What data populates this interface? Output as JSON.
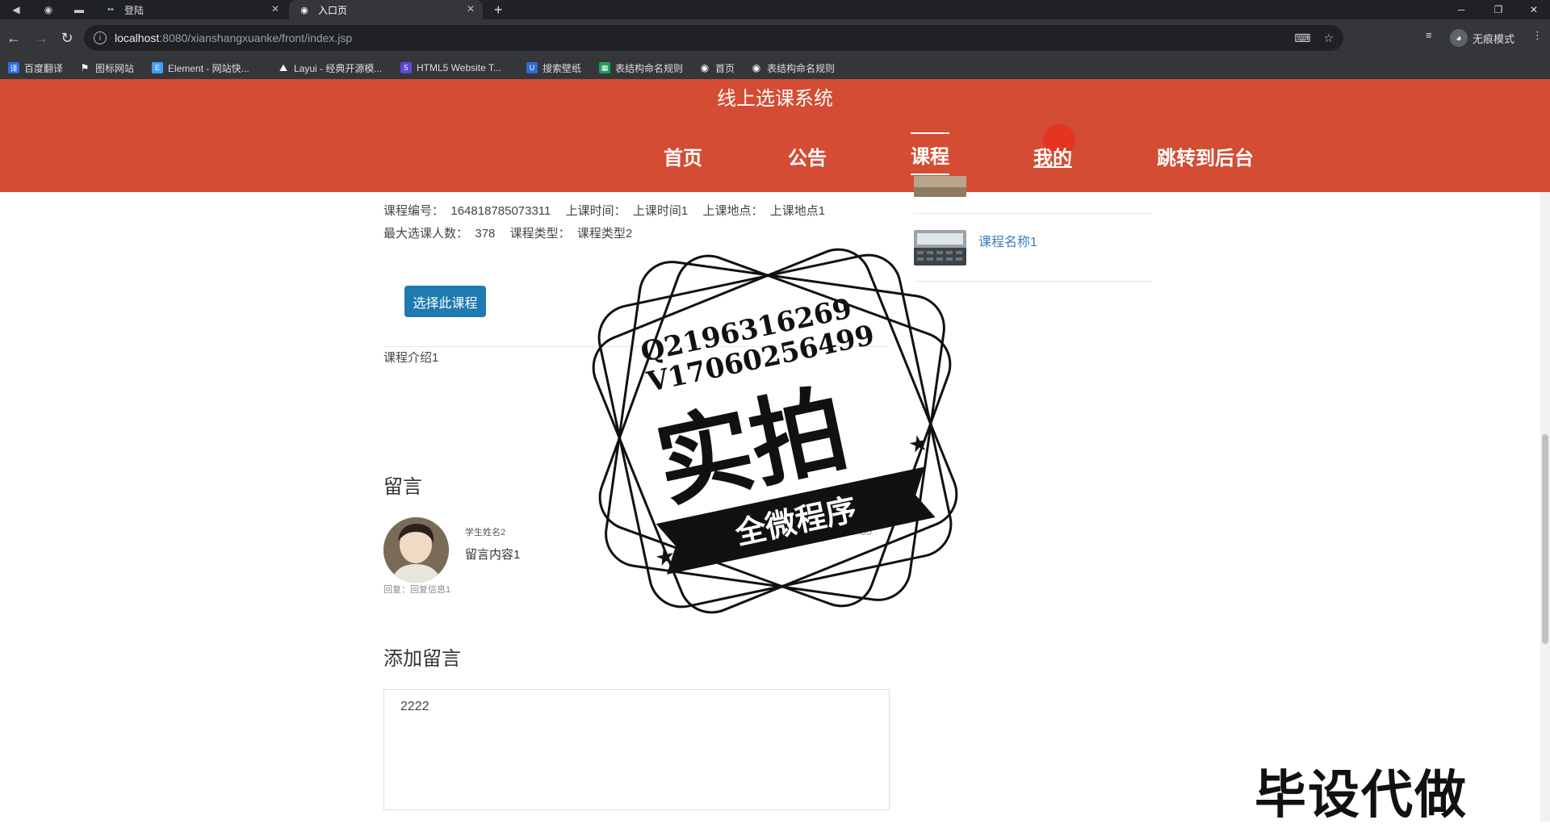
{
  "browser": {
    "tabs": [
      {
        "title": "登陆",
        "active": false
      },
      {
        "title": "入口页",
        "active": true
      }
    ],
    "url_host": "localhost",
    "url_rest": ":8080/xianshangxuanke/front/index.jsp",
    "profile_label": "无痕模式",
    "bookmarks": [
      {
        "label": "百度翻译",
        "icon": "baidu-translate-icon",
        "color": "#2f6ee6"
      },
      {
        "label": "图标网站",
        "icon": "flag-icon",
        "color": "#555555"
      },
      {
        "label": "Element - 网站快...",
        "icon": "element-icon",
        "color": "#409eff"
      },
      {
        "label": "Layui - 经典开源模...",
        "icon": "layui-icon",
        "color": "#444444"
      },
      {
        "label": "HTML5 Website T...",
        "icon": "html5-icon",
        "color": "#5b4bd6"
      },
      {
        "label": "搜索壁纸",
        "icon": "wallpaper-icon",
        "color": "#2b6bd6"
      },
      {
        "label": "表结构命名规则",
        "icon": "sheet-icon",
        "color": "#1e9e5a"
      },
      {
        "label": "首页",
        "icon": "globe-icon",
        "color": "#666666"
      },
      {
        "label": "表结构命名规则",
        "icon": "globe-icon",
        "color": "#666666"
      }
    ]
  },
  "header": {
    "site_title": "线上选课系统",
    "nav": [
      {
        "label": "首页",
        "active": false
      },
      {
        "label": "公告",
        "active": false
      },
      {
        "label": "课程",
        "active": true
      },
      {
        "label": "我的",
        "active": false
      },
      {
        "label": "跳转到后台",
        "active": false
      }
    ],
    "bg_color": "#d34c33"
  },
  "course": {
    "number_label": "课程编号：",
    "number_value": "164818785073311",
    "time_label": "上课时间：",
    "time_value": "上课时间1",
    "place_label": "上课地点：",
    "place_value": "上课地点1",
    "max_label": "最大选课人数：",
    "max_value": "378",
    "type_label": "课程类型：",
    "type_value": "课程类型2",
    "select_button": "选择此课程",
    "intro": "课程介绍1"
  },
  "comments": {
    "section_title": "留言",
    "items": [
      {
        "name": "学生姓名2",
        "content": "留言内容1",
        "reply": "回复：回复信息1",
        "time": ":37:30"
      }
    ]
  },
  "add_comment": {
    "section_title": "添加留言",
    "value": "2222"
  },
  "sidebar": {
    "items": [
      {
        "title": "课程名称1"
      }
    ]
  },
  "watermark": {
    "line1": "Q2196316269",
    "line2": "V17060256499",
    "big": "实拍",
    "ribbon": "全微程序",
    "corner": "毕设代做"
  }
}
